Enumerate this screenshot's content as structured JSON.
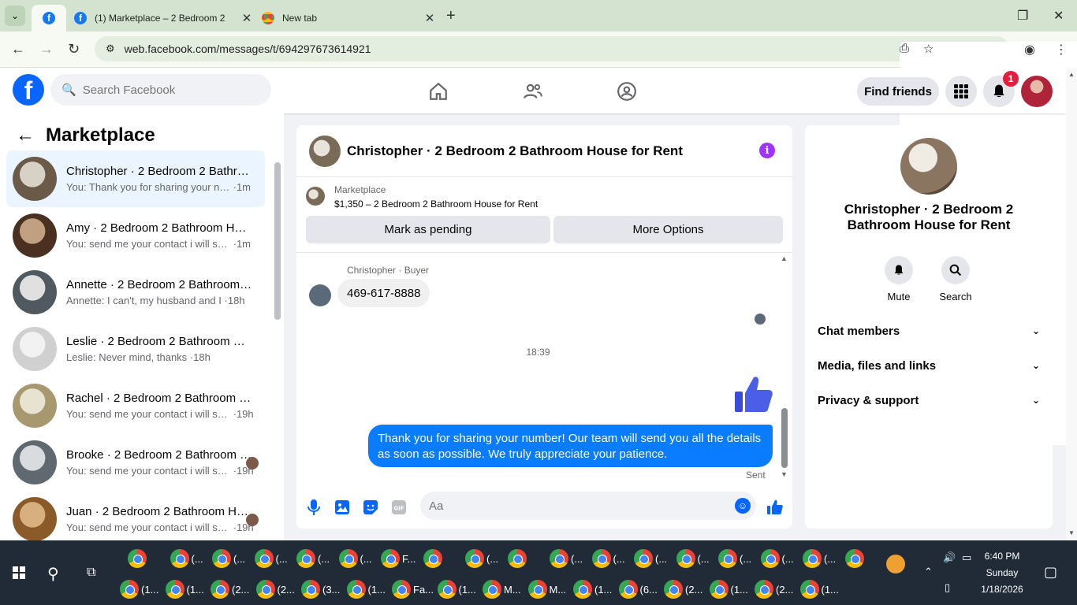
{
  "browser": {
    "tabs": [
      {
        "title": "",
        "active": true
      },
      {
        "title": "(1) Marketplace – 2 Bedroom 2"
      },
      {
        "title": "New tab"
      }
    ],
    "url": "web.facebook.com/messages/t/694297673614921"
  },
  "header": {
    "search_placeholder": "Search Facebook",
    "find_friends": "Find friends",
    "notification_count": "1"
  },
  "left": {
    "title": "Marketplace",
    "conversations": [
      {
        "name": "Christopher · 2 Bedroom 2 Bathroom House for Rent",
        "preview": "You: Thank you for sharing your number!",
        "time": "1m",
        "active": true,
        "c1": "#6b5a48",
        "c2": "#d8d2c6"
      },
      {
        "name": "Amy · 2 Bedroom 2 Bathroom House for Rent",
        "preview": "You: send me your contact i will send",
        "time": "1m",
        "c1": "#4a3020",
        "c2": "#c0a080"
      },
      {
        "name": "Annette · 2 Bedroom 2 Bathroom House for Rent",
        "preview": "Annette: I can't, my husband and I",
        "time": "18h",
        "c1": "#505860",
        "c2": "#e0e0e0"
      },
      {
        "name": "Leslie · 2 Bedroom 2 Bathroom House for Rent",
        "preview": "Leslie: Never mind, thanks",
        "time": "18h",
        "c1": "#d0d0d0",
        "c2": "#f2f2f2"
      },
      {
        "name": "Rachel · 2 Bedroom 2 Bathroom House for Rent",
        "preview": "You: send me your contact i will send",
        "time": "19h",
        "c1": "#a89870",
        "c2": "#e8e2d0"
      },
      {
        "name": "Brooke · 2 Bedroom 2 Bathroom House for Rent",
        "preview": "You: send me your contact i will send",
        "time": "19h",
        "c1": "#606870",
        "c2": "#d8dcdf"
      },
      {
        "name": "Juan · 2 Bedroom 2 Bathroom House for Rent",
        "preview": "You: send me your contact i will send",
        "time": "19h",
        "c1": "#8a5a28",
        "c2": "#d8b080"
      }
    ]
  },
  "chat": {
    "title": "Christopher · 2 Bedroom 2 Bathroom House for Rent",
    "listing_source": "Marketplace",
    "listing": "$1,350 – 2 Bedroom 2 Bathroom House for Rent",
    "mark_pending": "Mark as pending",
    "more_options": "More Options",
    "sender_label": "Christopher · Buyer",
    "incoming": "469-617-8888",
    "timestamp": "18:39",
    "outgoing": "Thank you for sharing your number!  Our team will send you all the details as soon as possible. We truly appreciate your patience.",
    "sent": "Sent",
    "input_placeholder": "Aa"
  },
  "right": {
    "name": "Christopher · 2 Bedroom 2 Bathroom House for Rent",
    "mute": "Mute",
    "search": "Search",
    "sections": [
      "Chat members",
      "Media, files and links",
      "Privacy & support"
    ]
  },
  "taskbar": {
    "row1": [
      "",
      "(...",
      "(...",
      "(...",
      "(...",
      "(...",
      "F...",
      "",
      "(...",
      "",
      "(...",
      "(...",
      "(...",
      "(...",
      "(...",
      "(...",
      "(...",
      ""
    ],
    "row2": [
      "(1...",
      "(1...",
      "(2...",
      "(2...",
      "(3...",
      "(1...",
      "Fa...",
      "(1...",
      "M...",
      "M...",
      "(1...",
      "(6...",
      "(2...",
      "(1...",
      "(2...",
      "(1..."
    ],
    "time": "6:40 PM",
    "day": "Sunday",
    "date": "1/18/2026"
  },
  "colors": {
    "fb_blue": "#0866ff",
    "bubble_out": "#0a7cff",
    "badge": "#e41e3f"
  }
}
